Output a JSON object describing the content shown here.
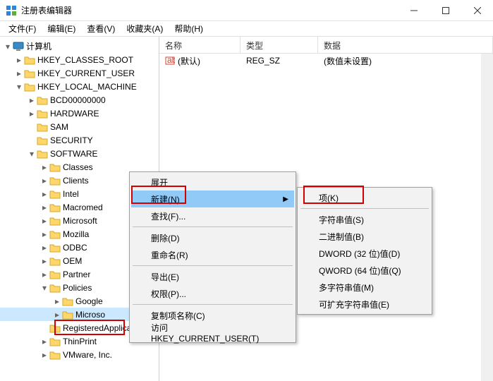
{
  "window": {
    "title": "注册表编辑器"
  },
  "menubar": {
    "items": [
      "文件(F)",
      "编辑(E)",
      "查看(V)",
      "收藏夹(A)",
      "帮助(H)"
    ]
  },
  "tree": {
    "root": "计算机",
    "hives": [
      "HKEY_CLASSES_ROOT",
      "HKEY_CURRENT_USER",
      "HKEY_LOCAL_MACHINE"
    ],
    "hklm_children": [
      "BCD00000000",
      "HARDWARE",
      "SAM",
      "SECURITY",
      "SOFTWARE"
    ],
    "software_children": [
      "Classes",
      "Clients",
      "Intel",
      "Macromed",
      "Microsoft",
      "Mozilla",
      "ODBC",
      "OEM",
      "Partner",
      "Policies",
      "RegisteredApplica",
      "ThinPrint",
      "VMware, Inc."
    ],
    "policies_children": [
      "Google",
      "Microso"
    ]
  },
  "list": {
    "headers": {
      "name": "名称",
      "type": "类型",
      "data": "数据"
    },
    "rows": [
      {
        "name": "(默认)",
        "type": "REG_SZ",
        "data": "(数值未设置)"
      }
    ]
  },
  "context_menu_1": {
    "items": {
      "expand": "展开",
      "new": "新建(N)",
      "find": "查找(F)...",
      "delete": "删除(D)",
      "rename": "重命名(R)",
      "export": "导出(E)",
      "permissions": "权限(P)...",
      "copykey": "复制项名称(C)",
      "goto": "访问 HKEY_CURRENT_USER(T)"
    }
  },
  "context_menu_2": {
    "items": {
      "key": "项(K)",
      "string": "字符串值(S)",
      "binary": "二进制值(B)",
      "dword": "DWORD (32 位)值(D)",
      "qword": "QWORD (64 位)值(Q)",
      "multi": "多字符串值(M)",
      "expand": "可扩充字符串值(E)"
    }
  }
}
